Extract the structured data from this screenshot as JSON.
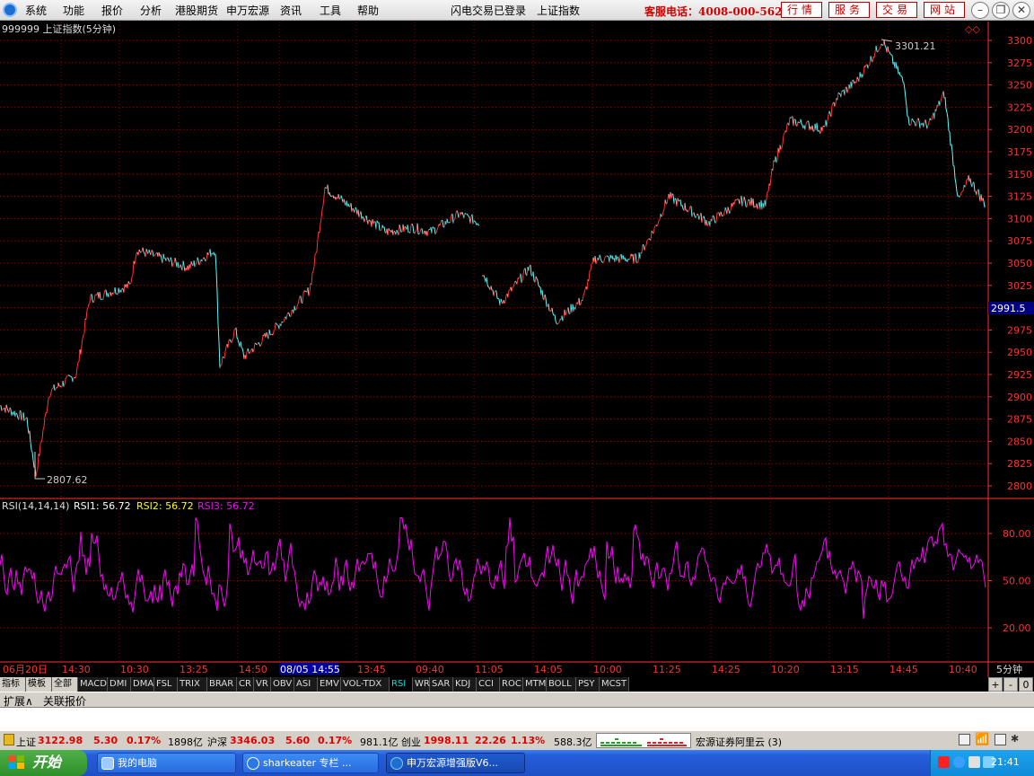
{
  "menu": {
    "items": [
      "系统",
      "功能",
      "报价",
      "分析",
      "港股期货",
      "申万宏源",
      "资讯",
      "工具",
      "帮助"
    ],
    "login_status": "闪电交易已登录",
    "current_index": "上证指数",
    "hotline": "客服电话：4008-000-562",
    "nav_buttons": [
      "行情",
      "服务",
      "交易",
      "网站"
    ]
  },
  "chart": {
    "code_title": "999999 上证指数(5分钟)",
    "high_label": "3301.21",
    "low_label": "2807.62",
    "current_price_tag": "2991.5",
    "price_ticks": [
      "3300",
      "3275",
      "3250",
      "3225",
      "3200",
      "3175",
      "3150",
      "3125",
      "3100",
      "3075",
      "3050",
      "3025",
      "3000",
      "2975",
      "2950",
      "2925",
      "2900",
      "2875",
      "2850",
      "2825",
      "2800"
    ],
    "rsi_header": "RSI(14,14,14)",
    "rsi1": "RSI1: 56.72",
    "rsi2": "RSI2: 56.72",
    "rsi3": "RSI3: 56.72",
    "rsi_ticks": [
      "80.00",
      "50.00",
      "20.00"
    ],
    "time_labels": [
      "06月20日",
      "14:30",
      "10:30",
      "13:25",
      "14:50",
      "08/05 14:55",
      "13:45",
      "09:40",
      "11:05",
      "14:05",
      "10:00",
      "11:25",
      "14:25",
      "10:20",
      "13:15",
      "14:45",
      "10:40"
    ],
    "period_label": "5分钟",
    "colors": {
      "up": "#ff3030",
      "down": "#54ffff",
      "rsi": "#ff00ff",
      "grid": "#8b0000",
      "axis": "#ff3030"
    }
  },
  "chart_data": {
    "type": "line",
    "title": "999999 上证指数(5分钟)",
    "ylim": [
      2800,
      3300
    ],
    "x": [
      "06月20日",
      "14:30",
      "10:30",
      "13:25",
      "14:50",
      "08/05 14:55",
      "13:45",
      "09:40",
      "11:05",
      "14:05",
      "10:00",
      "11:25",
      "14:25",
      "10:20",
      "13:15",
      "14:45",
      "10:40"
    ],
    "series": [
      {
        "name": "上证指数",
        "values": [
          2890,
          2820,
          2920,
          3010,
          3060,
          3030,
          2950,
          3000,
          3125,
          3090,
          3080,
          3100,
          3025,
          3050,
          2985,
          3060,
          3115,
          3105,
          3140,
          3215,
          3200,
          3260,
          3300,
          3250,
          3210,
          3240,
          3140,
          3110
        ]
      },
      {
        "name": "RSI1",
        "values": [
          56.72
        ]
      }
    ],
    "rsi_ylim": [
      0,
      100
    ]
  },
  "tabs": [
    "指标",
    "模板",
    "全部",
    "MACD",
    "DMI",
    "DMA",
    "FSL",
    "TRIX",
    "BRAR",
    "CR",
    "VR",
    "OBV",
    "ASI",
    "EMV",
    "VOL-TDX",
    "RSI",
    "WR",
    "SAR",
    "KDJ",
    "CCI",
    "ROC",
    "MTM",
    "BOLL",
    "PSY",
    "MCST"
  ],
  "active_tab": "RSI",
  "tab_controls": [
    "+",
    "-",
    "0"
  ],
  "expand": {
    "expand_label": "扩展∧",
    "related_label": "关联报价"
  },
  "status": {
    "sh_name": "上证",
    "sh_price": "3122.98",
    "sh_change": "5.30",
    "sh_pct": "0.17%",
    "sh_amount": "1898亿",
    "hs_name": "沪深",
    "hs_price": "3346.03",
    "hs_change": "5.60",
    "hs_pct": "0.17%",
    "hs_amount": "981.1亿",
    "cy_name": "创业",
    "cy_price": "1998.11",
    "cy_change": "22.26",
    "cy_pct": "1.13%",
    "cy_amount": "588.3亿",
    "broker": "宏源证券阿里云 (3)"
  },
  "taskbar": {
    "start": "开始",
    "tasks": [
      "我的电脑",
      "sharkeater 专栏 ...",
      "申万宏源增强版V6..."
    ],
    "clock": "21:41"
  }
}
